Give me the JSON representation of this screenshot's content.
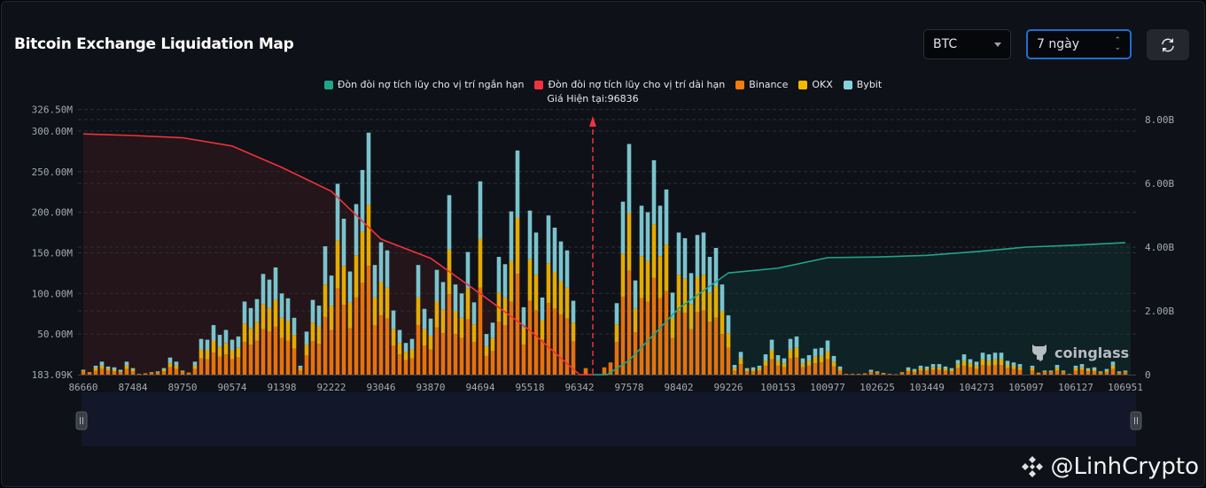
{
  "header": {
    "title": "Bitcoin Exchange Liquidation Map",
    "coin_select": "BTC",
    "range_select": "7 ngày",
    "refresh_icon": "refresh-icon"
  },
  "current_price_label": "Giá Hiện tại:96836",
  "watermark": {
    "brand": "coinglass",
    "handle": "@LinhCrypto",
    "handle_icon": "binance-logo-icon"
  },
  "colors": {
    "short_line": "#1fa58a",
    "long_line": "#f0323c",
    "binance": "#f57b0d",
    "okx": "#f5b800",
    "bybit": "#83d3dc",
    "current_price": "#f0323c"
  },
  "chart_data": {
    "type": "bar",
    "stacked": true,
    "legend_position": "top",
    "grid": true,
    "legend": [
      "Đòn đòi nợ tích lũy cho vị trí ngắn hạn",
      "Đòn đòi nợ tích lũy cho vị trí dài hạn",
      "Binance",
      "OKX",
      "Bybit"
    ],
    "current_price": 96836,
    "x_labels": [
      "86660",
      "87484",
      "89750",
      "90574",
      "91398",
      "92222",
      "93046",
      "93870",
      "94694",
      "95518",
      "96342",
      "97578",
      "98402",
      "99226",
      "100153",
      "100977",
      "102625",
      "103449",
      "104273",
      "105097",
      "106127",
      "106951"
    ],
    "left_axis": {
      "ticks": [
        "183.09K",
        "50.00M",
        "100.00M",
        "150.00M",
        "200.00M",
        "250.00M",
        "300.00M",
        "326.50M"
      ],
      "tick_values_m": [
        0.18309,
        50,
        100,
        150,
        200,
        250,
        300,
        326.5
      ]
    },
    "right_axis": {
      "ticks": [
        "0",
        "2.00B",
        "4.00B",
        "6.00B",
        "8.00B"
      ],
      "tick_values_b": [
        0,
        2,
        4,
        6,
        8
      ]
    },
    "bar_unit": "M",
    "series": [
      {
        "name": "Binance",
        "values": [
          4,
          2,
          5,
          7,
          5,
          4,
          3,
          7,
          4,
          1,
          1,
          2,
          2,
          4,
          9,
          7,
          3,
          2,
          7,
          20,
          19,
          27,
          22,
          25,
          19,
          21,
          40,
          37,
          42,
          56,
          53,
          59,
          45,
          42,
          32,
          5,
          24,
          41,
          38,
          71,
          55,
          106,
          86,
          57,
          95,
          113,
          134,
          61,
          73,
          69,
          36,
          25,
          18,
          20,
          61,
          36,
          31,
          58,
          51,
          99,
          50,
          45,
          68,
          40,
          107,
          23,
          29,
          65,
          61,
          90,
          124,
          37,
          91,
          79,
          43,
          88,
          81,
          74,
          69,
          41,
          0,
          8,
          0,
          0,
          9,
          15,
          40,
          96,
          128,
          52,
          94,
          90,
          119,
          94,
          103,
          45,
          79,
          76,
          56,
          77,
          79,
          65,
          70,
          50,
          33,
          5,
          13,
          4,
          4,
          5,
          11,
          19,
          11,
          9,
          20,
          21,
          9,
          11,
          14,
          15,
          19,
          10,
          5,
          1,
          1,
          1,
          1,
          3,
          2,
          1,
          1,
          0.5,
          2,
          4,
          3,
          5,
          5,
          6,
          6,
          5,
          4,
          8,
          11,
          9,
          7,
          12,
          11,
          12,
          12,
          8,
          7,
          6,
          0,
          5,
          2,
          3,
          3,
          5,
          3,
          1,
          5,
          6,
          4,
          4,
          2,
          3,
          7,
          2,
          3
        ]
      },
      {
        "name": "OKX",
        "values": [
          1,
          1,
          3,
          4,
          2,
          2,
          1,
          4,
          2,
          0,
          0.5,
          1,
          1,
          2,
          5,
          4,
          1,
          0.5,
          4,
          11,
          11,
          15,
          12,
          14,
          11,
          12,
          23,
          20,
          23,
          31,
          29,
          33,
          25,
          24,
          17,
          3,
          13,
          23,
          21,
          40,
          30,
          59,
          48,
          32,
          52,
          63,
          75,
          34,
          41,
          38,
          20,
          14,
          10,
          11,
          34,
          20,
          17,
          32,
          29,
          55,
          28,
          25,
          38,
          22,
          60,
          12,
          16,
          36,
          34,
          50,
          69,
          21,
          51,
          44,
          24,
          49,
          45,
          41,
          38,
          23,
          0,
          0,
          0,
          0,
          0,
          0,
          22,
          53,
          71,
          29,
          52,
          50,
          66,
          52,
          57,
          25,
          44,
          42,
          31,
          43,
          44,
          36,
          39,
          28,
          18,
          3,
          7,
          2,
          2,
          3,
          6,
          11,
          6,
          5,
          11,
          12,
          5,
          6,
          8,
          8,
          10,
          6,
          2,
          0,
          0,
          0,
          0.5,
          1,
          1,
          1,
          0,
          0,
          1,
          2,
          2,
          3,
          2,
          3,
          3,
          2,
          2,
          5,
          6,
          5,
          4,
          7,
          6,
          7,
          7,
          4,
          4,
          3,
          0,
          3,
          0.5,
          1,
          1,
          3,
          1,
          0,
          3,
          3,
          2,
          2,
          1,
          2,
          4,
          1,
          1
        ]
      },
      {
        "name": "Bybit",
        "values": [
          1,
          0,
          3,
          5,
          3,
          3,
          2,
          5,
          2,
          0,
          0,
          0,
          1,
          2,
          7,
          5,
          1,
          0,
          5,
          13,
          13,
          19,
          15,
          16,
          13,
          14,
          27,
          25,
          28,
          37,
          35,
          40,
          30,
          28,
          21,
          3,
          16,
          28,
          26,
          47,
          37,
          70,
          58,
          38,
          63,
          76,
          89,
          40,
          49,
          46,
          23,
          16,
          11,
          13,
          40,
          25,
          21,
          39,
          34,
          67,
          33,
          30,
          45,
          27,
          71,
          15,
          19,
          44,
          41,
          61,
          83,
          25,
          60,
          52,
          28,
          59,
          55,
          49,
          46,
          27,
          0,
          0,
          0,
          0,
          0,
          0,
          26,
          64,
          85,
          35,
          62,
          60,
          79,
          62,
          68,
          31,
          52,
          50,
          38,
          52,
          52,
          44,
          47,
          33,
          22,
          4,
          8,
          2,
          3,
          3,
          8,
          13,
          7,
          6,
          13,
          14,
          6,
          7,
          10,
          10,
          13,
          7,
          3,
          0,
          0,
          0,
          0,
          2,
          1,
          0,
          0,
          0,
          0,
          3,
          2,
          3,
          3,
          4,
          4,
          3,
          2,
          5,
          8,
          5,
          5,
          8,
          8,
          8,
          8,
          5,
          4,
          4,
          0,
          3,
          0,
          1,
          1,
          4,
          1,
          0,
          3,
          4,
          2,
          3,
          1,
          2,
          5,
          1,
          1
        ]
      }
    ],
    "lines_unit": "B",
    "lines": [
      {
        "name": "Đòn đòi nợ tích lũy cho vị trí dài hạn",
        "axis": "right",
        "values_at_labels": [
          7.55,
          7.5,
          7.43,
          7.17,
          6.5,
          5.75,
          4.25,
          3.65,
          2.54,
          1.39,
          0,
          null,
          null,
          null,
          null,
          null,
          null,
          null,
          null,
          null,
          null,
          null
        ]
      },
      {
        "name": "Đòn đòi nợ tích lũy cho vị trí ngắn hạn",
        "axis": "right",
        "values_at_labels": [
          null,
          null,
          null,
          null,
          null,
          null,
          null,
          null,
          null,
          null,
          null,
          0.45,
          2.08,
          3.19,
          3.34,
          3.67,
          3.69,
          3.74,
          3.86,
          4.0,
          4.06,
          4.14
        ]
      }
    ]
  }
}
